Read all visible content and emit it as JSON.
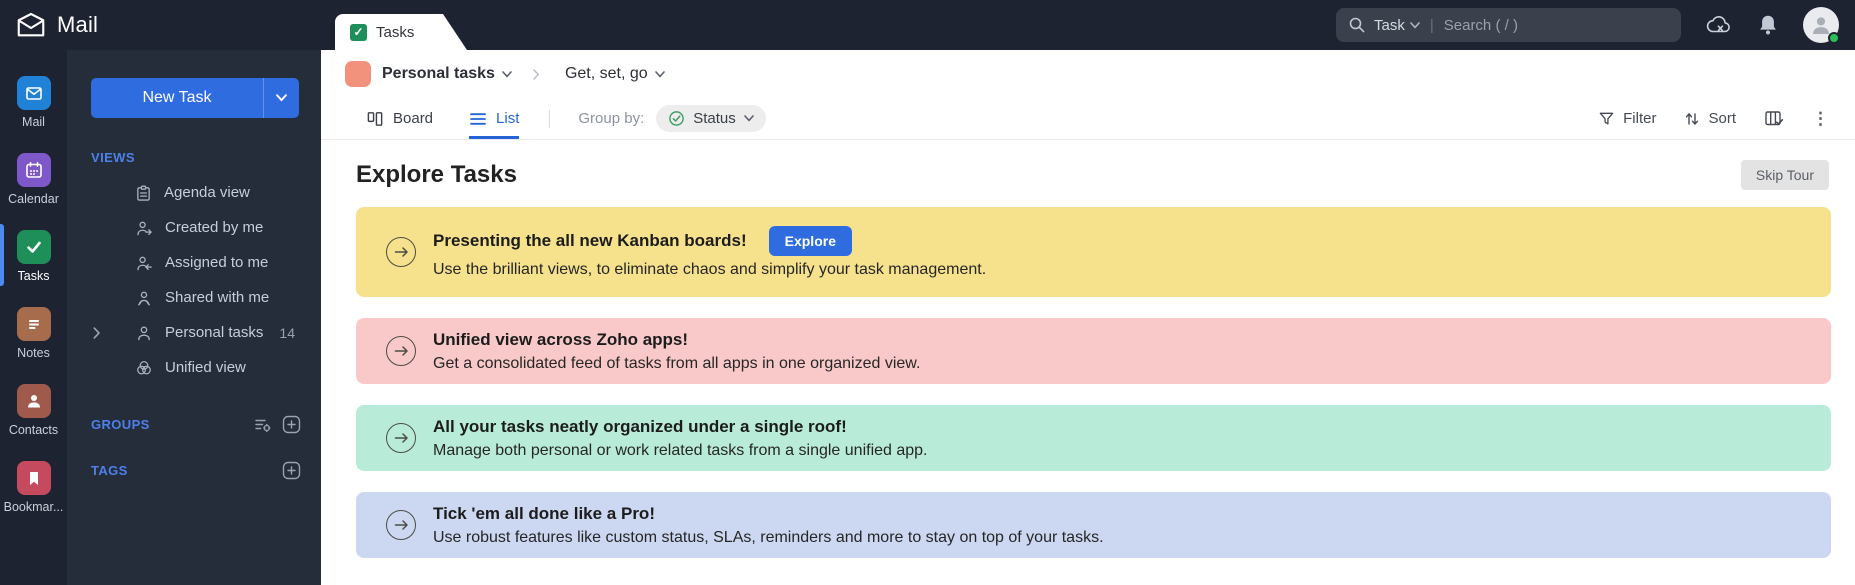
{
  "app": {
    "name": "Mail"
  },
  "topbar": {
    "search_scope": "Task",
    "search_placeholder": "Search ( / )"
  },
  "rail": {
    "items": [
      {
        "label": "Mail",
        "color": "#2082d6",
        "active": false
      },
      {
        "label": "Calendar",
        "color": "#7e57c8",
        "active": false
      },
      {
        "label": "Tasks",
        "color": "#1f8f5a",
        "active": true
      },
      {
        "label": "Notes",
        "color": "#a66c4b",
        "active": false
      },
      {
        "label": "Contacts",
        "color": "#9f5a4b",
        "active": false
      },
      {
        "label": "Bookmar...",
        "color": "#c64a5e",
        "active": false
      }
    ]
  },
  "sidebar": {
    "new_task_label": "New Task",
    "views_header": "VIEWS",
    "views": [
      {
        "label": "Agenda view"
      },
      {
        "label": "Created by me"
      },
      {
        "label": "Assigned to me"
      },
      {
        "label": "Shared with me"
      },
      {
        "label": "Personal tasks",
        "count": "14"
      },
      {
        "label": "Unified view"
      }
    ],
    "groups_header": "GROUPS",
    "tags_header": "TAGS"
  },
  "main": {
    "tab_label": "Tasks",
    "breadcrumb": {
      "list_label": "Personal tasks",
      "list_color": "#f2917c",
      "view_label": "Get, set, go"
    },
    "toolbar": {
      "board_label": "Board",
      "list_label": "List",
      "group_by_label": "Group by:",
      "status_label": "Status",
      "filter_label": "Filter",
      "sort_label": "Sort"
    },
    "page_title": "Explore Tasks",
    "skip_tour_label": "Skip Tour",
    "banners": [
      {
        "title": "Presenting the all new Kanban boards!",
        "description": "Use the brilliant views, to eliminate chaos and simplify your task management.",
        "bg": "#f6e28d",
        "cta": "Explore"
      },
      {
        "title": "Unified view across Zoho apps!",
        "description": "Get a consolidated feed of tasks from all apps in one organized view.",
        "bg": "#f8c9c8"
      },
      {
        "title": "All your tasks neatly organized under a single roof!",
        "description": "Manage both personal or work related tasks from a single unified app.",
        "bg": "#b9ecd8"
      },
      {
        "title": "Tick 'em all done like a Pro!",
        "description": "Use robust features like custom status, SLAs, reminders and more to stay on top of your tasks.",
        "bg": "#ccd7f1"
      }
    ]
  },
  "colors": {
    "accent_blue": "#2e6ce0",
    "topbar_bg": "#1d2330",
    "sidebar_bg": "#252d3b",
    "status_check_green": "#3f9e63"
  }
}
